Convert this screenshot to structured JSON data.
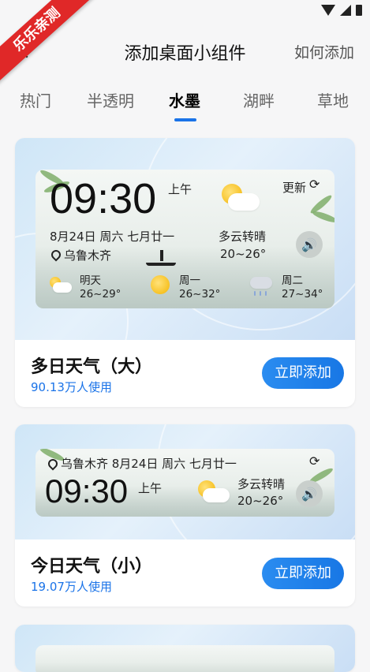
{
  "ribbon": "乐乐亲测",
  "header": {
    "title": "添加桌面小组件",
    "how_to": "如何添加"
  },
  "tabs": [
    "热门",
    "半透明",
    "水墨",
    "湖畔",
    "草地"
  ],
  "active_tab": "水墨",
  "cards": [
    {
      "name": "多日天气（大）",
      "users": "90.13万人使用",
      "button": "立即添加",
      "widget": {
        "time": "09:30",
        "ampm": "上午",
        "update": "更新",
        "date": "8月24日  周六  七月廿一",
        "location": "乌鲁木齐",
        "condition": "多云转晴",
        "temp": "20~26°",
        "forecast": [
          {
            "day": "明天",
            "temp": "26~29°",
            "icon": "partly-cloudy-icon"
          },
          {
            "day": "周一",
            "temp": "26~32°",
            "icon": "sun-icon"
          },
          {
            "day": "周二",
            "temp": "27~34°",
            "icon": "rain-icon"
          }
        ]
      }
    },
    {
      "name": "今日天气（小）",
      "users": "19.07万人使用",
      "button": "立即添加",
      "widget": {
        "header": "乌鲁木齐  8月24日  周六  七月廿一",
        "time": "09:30",
        "ampm": "上午",
        "condition": "多云转晴",
        "temp": "20~26°"
      }
    }
  ]
}
